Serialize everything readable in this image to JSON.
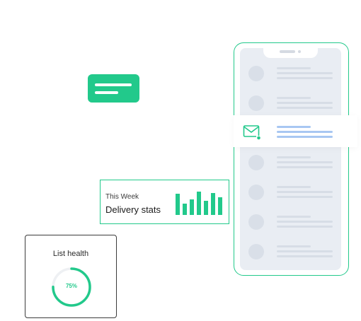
{
  "colors": {
    "accent": "#22c98b",
    "highlight_line": "#a8c7f2",
    "card_border": "#3c3c3c"
  },
  "icons": {
    "bubble": "chat-bubble-icon",
    "mail": "mail-icon"
  },
  "stats_card": {
    "week_label": "This Week",
    "title": "Delivery stats",
    "bar_levels": [
      0.82,
      0.45,
      0.6,
      0.92,
      0.55,
      0.85,
      0.7
    ]
  },
  "health_card": {
    "title": "List health",
    "percent_label": "75%",
    "percent": 75
  }
}
